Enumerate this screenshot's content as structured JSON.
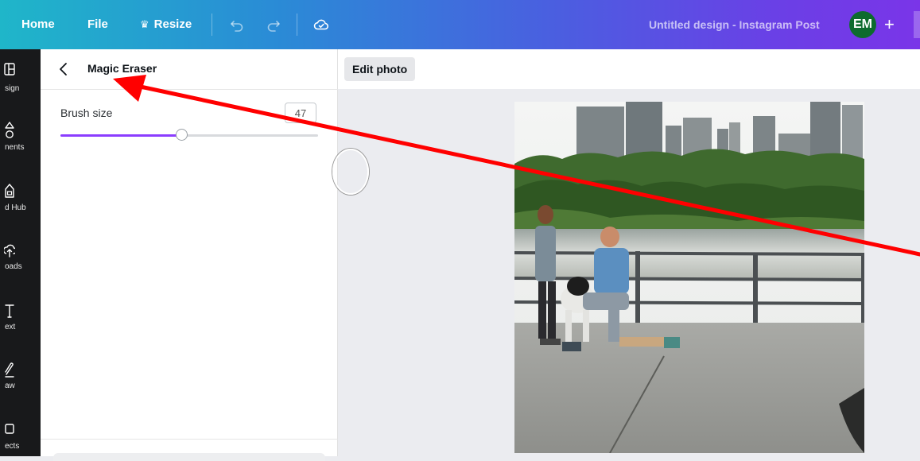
{
  "topbar": {
    "home": "Home",
    "file": "File",
    "resize": "Resize",
    "design_title": "Untitled design - Instagram Post",
    "avatar_initials": "EM",
    "add": "+"
  },
  "rail": {
    "items": [
      {
        "label": "sign",
        "icon": "layout-icon"
      },
      {
        "label": "nents",
        "icon": "shapes-icon"
      },
      {
        "label": "d Hub",
        "icon": "brand-hub-icon"
      },
      {
        "label": "oads",
        "icon": "upload-icon"
      },
      {
        "label": "ext",
        "icon": "text-icon"
      },
      {
        "label": "aw",
        "icon": "draw-icon"
      },
      {
        "label": "ects",
        "icon": "projects-icon"
      }
    ]
  },
  "panel": {
    "title": "Magic Eraser",
    "brush_label": "Brush size",
    "brush_value": "47",
    "brush_level": 0.47
  },
  "canvas": {
    "edit_photo": "Edit photo"
  },
  "colors": {
    "accent": "#8b3dff",
    "annotation_arrow": "#ff0000",
    "avatar_bg": "#0d6b2e"
  }
}
